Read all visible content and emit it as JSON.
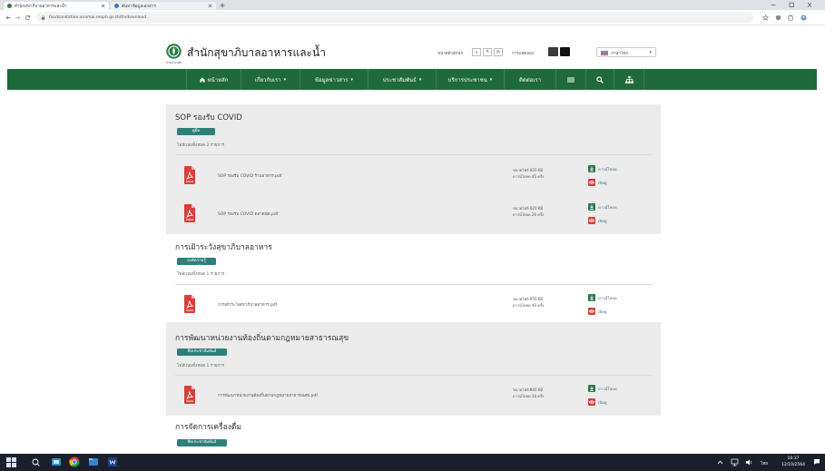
{
  "browser": {
    "tabs": [
      {
        "title": "สำนักสุขาภิบาลอาหารและน้ำ"
      },
      {
        "title": "ค้นหาข้อมูลเอกสาร"
      }
    ],
    "url": "foodsanitation.anamai.moph.go.th/th/download"
  },
  "site": {
    "title": "สำนักสุขาภิบาลอาหารและน้ำ",
    "logo_caption": "กรมอนามัย",
    "font_size_label": "ขนาดตัวอักษร",
    "font_sizes": [
      "ก",
      "ก",
      "ก"
    ],
    "display_label": "การแสดงผล",
    "language": "ภาษาไทย"
  },
  "nav": {
    "items": [
      {
        "label": "หน้าหลัก"
      },
      {
        "label": "เกี่ยวกับเรา"
      },
      {
        "label": "ข้อมูลข่าวสาร"
      },
      {
        "label": "ประชาสัมพันธ์"
      },
      {
        "label": "บริการประชาชน"
      },
      {
        "label": "ติดต่อเรา"
      }
    ],
    "icons": [
      "menu-icon",
      "search-icon",
      "sitemap-icon"
    ]
  },
  "file_actions": {
    "download": "ดาวน์โหลด",
    "view": "เปิดดู"
  },
  "sections": [
    {
      "title": "SOP รองรับ COVID",
      "tag": "คู่มือ",
      "count_text": "ไฟล์แนบทั้งหมด 2 รายการ",
      "files": [
        {
          "name": "SOP รองรับ COVID ร้านอาหาร.pdf",
          "size": "ขนาดไฟล์ 820 KB",
          "downloads": "ดาวน์โหลด 45 ครั้ง"
        },
        {
          "name": "SOP รองรับ COVID ตลาดนัด.pdf",
          "size": "ขนาดไฟล์ 620 KB",
          "downloads": "ดาวน์โหลด 26 ครั้ง"
        }
      ]
    },
    {
      "title": "การเฝ้าระวังสุขาภิบาลอาหาร",
      "tag": "องค์ความรู้",
      "count_text": "ไฟล์แนบทั้งหมด 1 รายการ",
      "files": [
        {
          "name": "การเฝ้าระวังสุขาภิบาลอาหาร.pdf",
          "size": "ขนาดไฟล์ 956 KB",
          "downloads": "ดาวน์โหลด 40 ครั้ง"
        }
      ]
    },
    {
      "title": "การพัฒนาหน่วยงานท้องถิ่นตามกฎหมายสาธารณสุข",
      "tag": "สื่อประชาสัมพันธ์",
      "count_text": "ไฟล์แนบทั้งหมด 1 รายการ",
      "files": [
        {
          "name": "การพัฒนาหน่วยงานท้องถิ่นตามกฎหมายสาธารณสุข.pdf",
          "size": "ขนาดไฟล์ 840 KB",
          "downloads": "ดาวน์โหลด 38 ครั้ง"
        }
      ]
    },
    {
      "title": "การจัดการเครื่องดื่ม",
      "tag": "สื่อประชาสัมพันธ์"
    }
  ],
  "taskbar": {
    "language": "ไทย",
    "time": "10:37",
    "date": "12/10/2564"
  },
  "colors": {
    "nav": "#1f6a3a",
    "tag": "#2e7f7a",
    "panel": "#ececec",
    "pdf": "#d6403a",
    "download": "#2d7a4a",
    "taskbar": "#1b1f2b"
  }
}
